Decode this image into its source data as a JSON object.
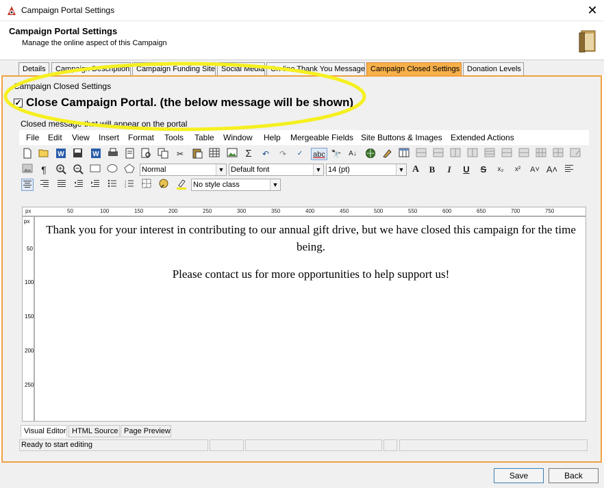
{
  "window": {
    "title": "Campaign Portal Settings",
    "close_glyph": "✕"
  },
  "header": {
    "title": "Campaign Portal Settings",
    "subtitle": "Manage the online aspect of this Campaign"
  },
  "tabs": [
    {
      "label": "Details"
    },
    {
      "label": "Campaign Description"
    },
    {
      "label": "Campaign Funding Site"
    },
    {
      "label": "Social Media"
    },
    {
      "label": "On-line Thank You Message"
    },
    {
      "label": "Campaign Closed Settings"
    },
    {
      "label": "Donation Levels"
    }
  ],
  "closed_settings": {
    "section_title": "Campaign Closed Settings",
    "checkbox_label": "Close Campaign Portal. (the below message will be shown)",
    "checkbox_checked": true,
    "checkmark": "✓",
    "message_label": "Closed message that will appear on the portal"
  },
  "editor": {
    "menu": [
      "File",
      "Edit",
      "View",
      "Insert",
      "Format",
      "Tools",
      "Table",
      "Window",
      "Help",
      "Mergeable Fields",
      "Site Buttons & Images",
      "Extended Actions"
    ],
    "paragraph_style": "Normal",
    "font": "Default font",
    "font_size": "14 (pt)",
    "style_class": "No style class",
    "ruler_unit": "px",
    "ruler_ticks": [
      "50",
      "100",
      "150",
      "200",
      "250",
      "300",
      "350",
      "400",
      "450",
      "500",
      "550",
      "600",
      "650",
      "700",
      "750"
    ],
    "vruler_ticks": [
      "50",
      "100",
      "150",
      "200",
      "250"
    ],
    "content": {
      "paragraph1": "Thank you for your interest in contributing to our annual gift drive, but we have closed this campaign for the time being.",
      "paragraph2": "Please contact us for more opportunities to help support us!"
    },
    "view_tabs": [
      "Visual Editor",
      "HTML Source",
      "Page Preview"
    ],
    "status": "Ready to start editing"
  },
  "footer": {
    "save_label": "Save",
    "back_label": "Back"
  },
  "colors": {
    "active_tab": "#f7b04a",
    "content_border": "#f0a040",
    "annotation": "#f5f020"
  }
}
